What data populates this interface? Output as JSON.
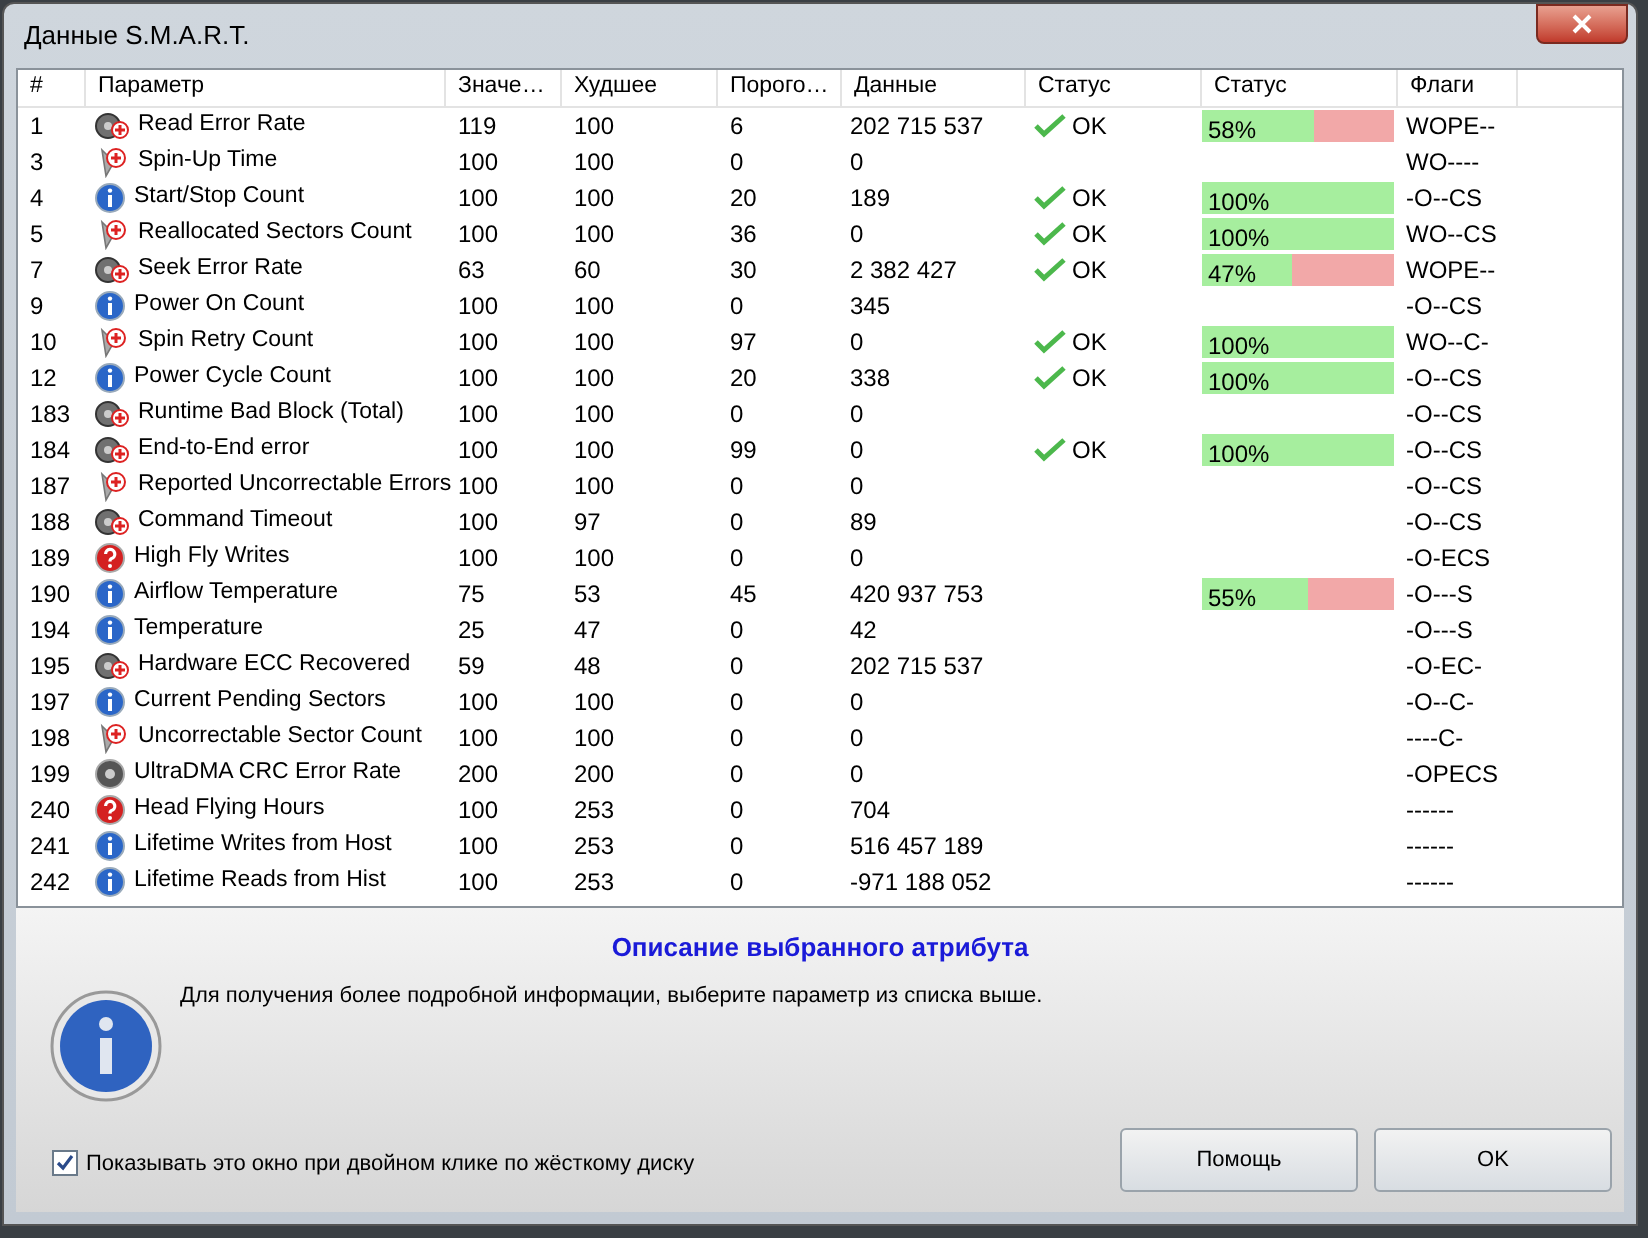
{
  "window": {
    "title": "Данные S.M.A.R.T."
  },
  "table": {
    "columns": [
      "#",
      "Параметр",
      "Значе…",
      "Худшее",
      "Порого…",
      "Данные",
      "Статус",
      "Статус",
      "Флаги"
    ],
    "rows": [
      {
        "id": "1",
        "kind": "disk",
        "name": "Read Error Rate",
        "value": "119",
        "worst": "100",
        "threshold": "6",
        "data": "202 715 537",
        "status": "OK",
        "level": 0.58,
        "percent": "58%",
        "flags": "WOPE--"
      },
      {
        "id": "3",
        "kind": "pin",
        "name": "Spin-Up Time",
        "value": "100",
        "worst": "100",
        "threshold": "0",
        "data": "0",
        "flags": "WO----"
      },
      {
        "id": "4",
        "kind": "info",
        "name": "Start/Stop Count",
        "value": "100",
        "worst": "100",
        "threshold": "20",
        "data": "189",
        "status": "OK",
        "level": 1,
        "percent": "100%",
        "flags": "-O--CS"
      },
      {
        "id": "5",
        "kind": "pin",
        "name": "Reallocated Sectors Count",
        "value": "100",
        "worst": "100",
        "threshold": "36",
        "data": "0",
        "status": "OK",
        "level": 1,
        "percent": "100%",
        "flags": "WO--CS"
      },
      {
        "id": "7",
        "kind": "disk",
        "name": "Seek Error Rate",
        "value": "63",
        "worst": "60",
        "threshold": "30",
        "data": "2 382 427",
        "status": "OK",
        "level": 0.47,
        "percent": "47%",
        "flags": "WOPE--"
      },
      {
        "id": "9",
        "kind": "info",
        "name": "Power On Count",
        "value": "100",
        "worst": "100",
        "threshold": "0",
        "data": "345",
        "flags": "-O--CS"
      },
      {
        "id": "10",
        "kind": "pin",
        "name": "Spin Retry Count",
        "value": "100",
        "worst": "100",
        "threshold": "97",
        "data": "0",
        "status": "OK",
        "level": 1,
        "percent": "100%",
        "flags": "WO--C-"
      },
      {
        "id": "12",
        "kind": "info",
        "name": "Power Cycle Count",
        "value": "100",
        "worst": "100",
        "threshold": "20",
        "data": "338",
        "status": "OK",
        "level": 1,
        "percent": "100%",
        "flags": "-O--CS"
      },
      {
        "id": "183",
        "kind": "disk",
        "name": "Runtime Bad Block (Total)",
        "value": "100",
        "worst": "100",
        "threshold": "0",
        "data": "0",
        "flags": "-O--CS"
      },
      {
        "id": "184",
        "kind": "disk",
        "name": "End-to-End error",
        "value": "100",
        "worst": "100",
        "threshold": "99",
        "data": "0",
        "status": "OK",
        "level": 1,
        "percent": "100%",
        "flags": "-O--CS"
      },
      {
        "id": "187",
        "kind": "pin",
        "name": "Reported Uncorrectable Errors",
        "value": "100",
        "worst": "100",
        "threshold": "0",
        "data": "0",
        "flags": "-O--CS"
      },
      {
        "id": "188",
        "kind": "disk",
        "name": "Command Timeout",
        "value": "100",
        "worst": "97",
        "threshold": "0",
        "data": "89",
        "flags": "-O--CS"
      },
      {
        "id": "189",
        "kind": "question",
        "name": "High Fly Writes",
        "value": "100",
        "worst": "100",
        "threshold": "0",
        "data": "0",
        "flags": "-O-ECS"
      },
      {
        "id": "190",
        "kind": "info",
        "name": "Airflow Temperature",
        "value": "75",
        "worst": "53",
        "threshold": "45",
        "data": "420 937 753",
        "level": 0.55,
        "percent": "55%",
        "flags": "-O---S"
      },
      {
        "id": "194",
        "kind": "info",
        "name": "Temperature",
        "value": "25",
        "worst": "47",
        "threshold": "0",
        "data": "42",
        "flags": "-O---S"
      },
      {
        "id": "195",
        "kind": "disk",
        "name": "Hardware ECC Recovered",
        "value": "59",
        "worst": "48",
        "threshold": "0",
        "data": "202 715 537",
        "flags": "-O-EC-"
      },
      {
        "id": "197",
        "kind": "info",
        "name": "Current Pending Sectors",
        "value": "100",
        "worst": "100",
        "threshold": "0",
        "data": "0",
        "flags": "-O--C-"
      },
      {
        "id": "198",
        "kind": "pin",
        "name": "Uncorrectable Sector Count",
        "value": "100",
        "worst": "100",
        "threshold": "0",
        "data": "0",
        "flags": "----C-"
      },
      {
        "id": "199",
        "kind": "plain",
        "name": "UltraDMA CRC Error Rate",
        "value": "200",
        "worst": "200",
        "threshold": "0",
        "data": "0",
        "flags": "-OPECS"
      },
      {
        "id": "240",
        "kind": "question",
        "name": "Head Flying Hours",
        "value": "100",
        "worst": "253",
        "threshold": "0",
        "data": "704",
        "flags": "------"
      },
      {
        "id": "241",
        "kind": "info",
        "name": "Lifetime Writes from Host",
        "value": "100",
        "worst": "253",
        "threshold": "0",
        "data": "516 457 189",
        "flags": "------"
      },
      {
        "id": "242",
        "kind": "info",
        "name": "Lifetime Reads from Hist",
        "value": "100",
        "worst": "253",
        "threshold": "0",
        "data": "-971 188 052",
        "flags": "------"
      }
    ]
  },
  "description": {
    "title": "Описание выбранного атрибута",
    "text": "Для получения более подробной информации, выберите параметр из списка выше."
  },
  "show_on_double_click": {
    "label": "Показывать это окно при двойном клике по жёсткому диску",
    "checked": true
  },
  "buttons": [
    "Помощь",
    "OK"
  ]
}
